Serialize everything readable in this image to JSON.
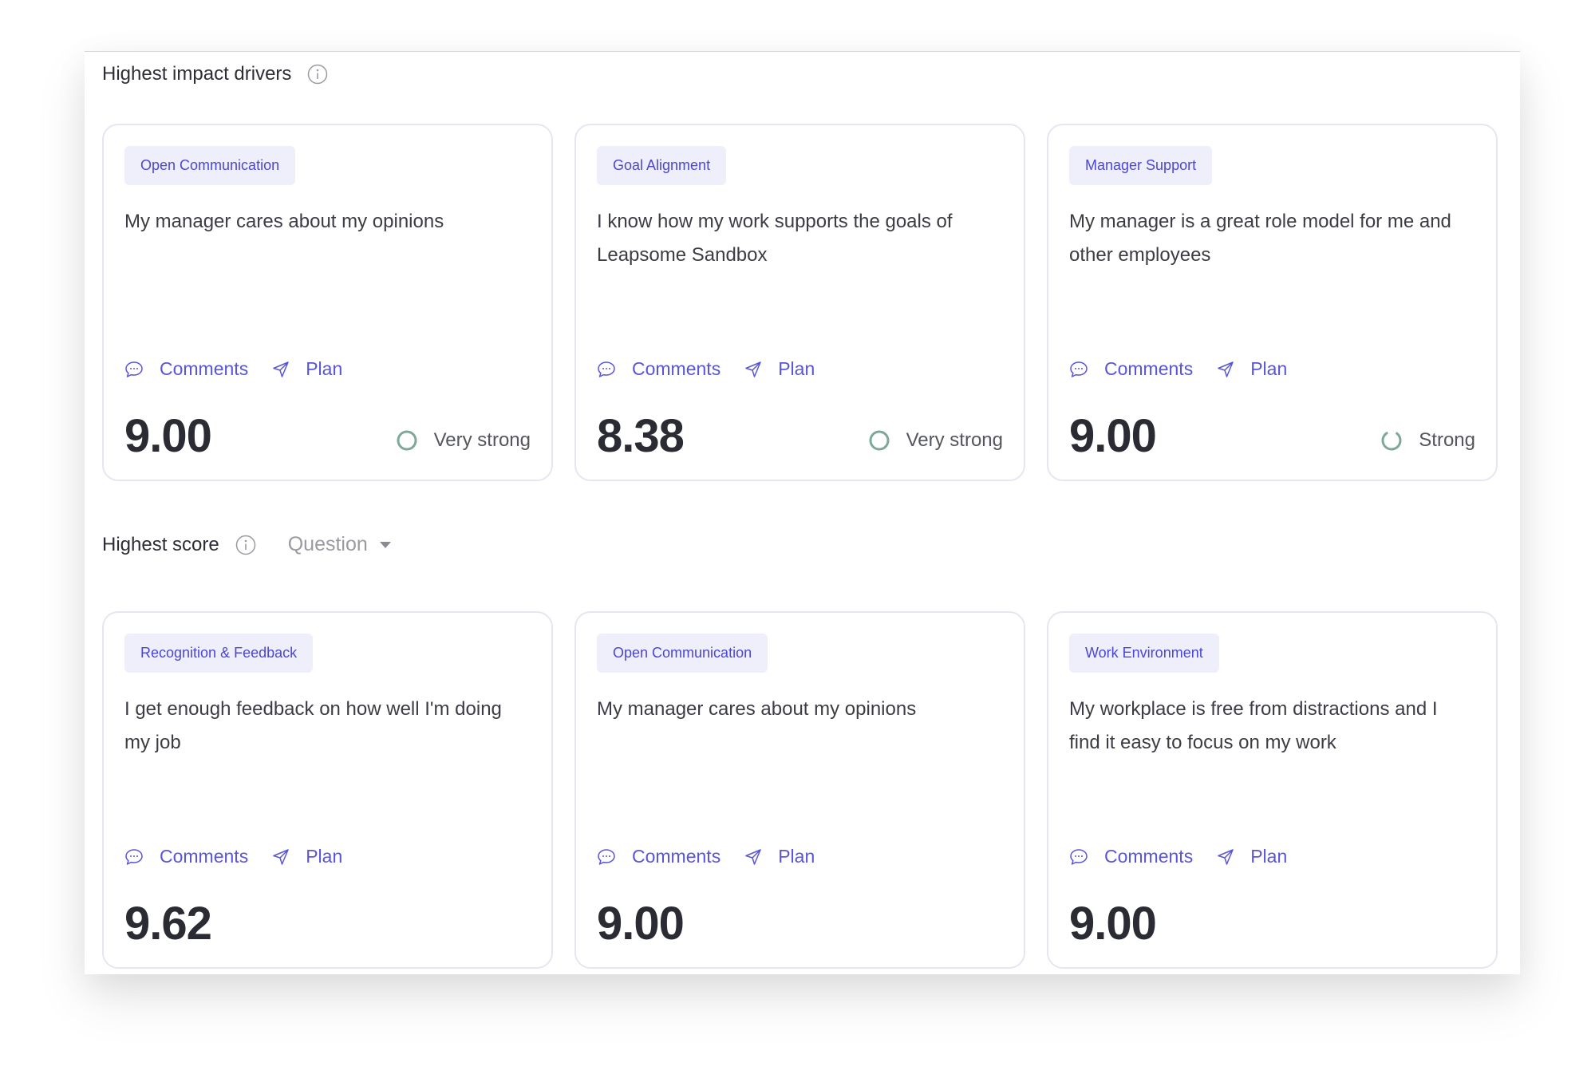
{
  "sections": {
    "impact": {
      "title": "Highest impact drivers",
      "cards": [
        {
          "tag": "Open Communication",
          "question": "My manager cares about my opinions",
          "comments": "Comments",
          "plan": "Plan",
          "score": "9.00",
          "strength": "Very strong"
        },
        {
          "tag": "Goal Alignment",
          "question": "I know how my work supports the goals of Leapsome Sandbox",
          "comments": "Comments",
          "plan": "Plan",
          "score": "8.38",
          "strength": "Very strong"
        },
        {
          "tag": "Manager Support",
          "question": "My manager is a great role model for me and other employees",
          "comments": "Comments",
          "plan": "Plan",
          "score": "9.00",
          "strength": "Strong"
        }
      ]
    },
    "score": {
      "title": "Highest score",
      "filter_value": "Question",
      "cards": [
        {
          "tag": "Recognition & Feedback",
          "question": "I get enough feedback on how well I'm doing my job",
          "comments": "Comments",
          "plan": "Plan",
          "score": "9.62"
        },
        {
          "tag": "Open Communication",
          "question": "My manager cares about my opinions",
          "comments": "Comments",
          "plan": "Plan",
          "score": "9.00"
        },
        {
          "tag": "Work Environment",
          "question": "My workplace is free from distractions and I find it easy to focus on my work",
          "comments": "Comments",
          "plan": "Plan",
          "score": "9.00"
        }
      ]
    }
  },
  "colors": {
    "accent": "#5a55d8",
    "tag_bg": "#efeffc",
    "strength_ring": "#7fa89a"
  },
  "icons": {
    "info": "info-icon",
    "comments": "speech-bubble-icon",
    "plan": "paper-plane-icon",
    "dropdown": "caret-down-icon",
    "strength_full": "full-ring-icon",
    "strength_partial": "partial-ring-icon"
  }
}
